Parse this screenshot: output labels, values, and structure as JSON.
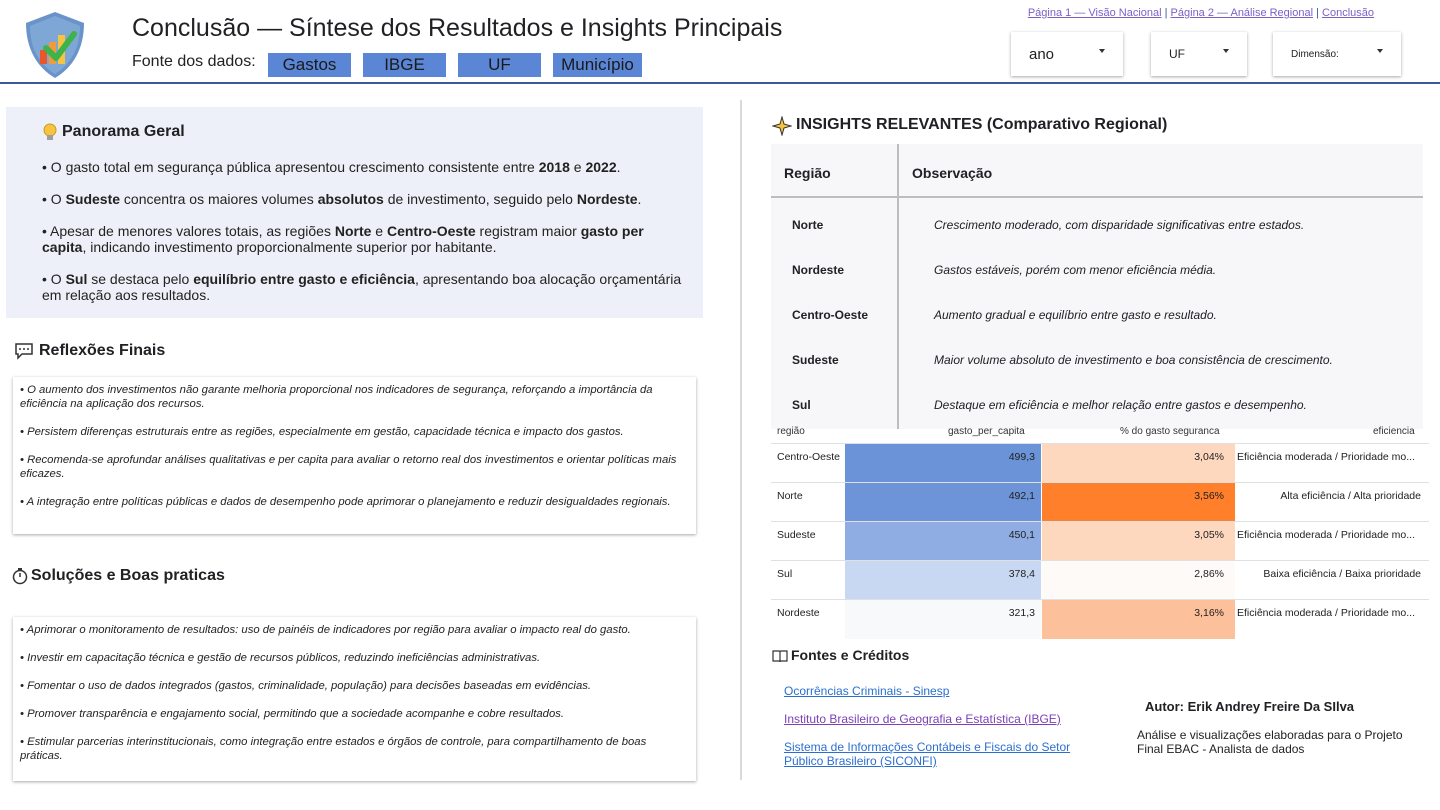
{
  "header": {
    "title": "Conclusão — Síntese dos Resultados e Insights Principais",
    "source_label": "Fonte dos dados:",
    "sources": [
      "Gastos",
      "IBGE",
      "UF",
      "Município"
    ],
    "nav": {
      "page1": "Página 1 — Visão Nacional",
      "sep1": " | ",
      "page2": "Página 2 — Análise Regional",
      "sep2": " | ",
      "page3": "Conclusão"
    },
    "filters": {
      "ano": "ano",
      "uf": "UF",
      "dimensao": "Dimensão:"
    }
  },
  "panorama": {
    "title": "Panorama Geral",
    "p1": {
      "a": "• O gasto total em segurança pública apresentou crescimento consistente entre ",
      "b": "2018",
      "c": " e ",
      "d": "2022",
      "e": "."
    },
    "p2": {
      "a": " • O ",
      "b": "Sudeste",
      "c": " concentra os maiores volumes ",
      "d": "absolutos",
      "e": " de investimento, seguido pelo ",
      "f": "Nordeste",
      "g": "."
    },
    "p3": {
      "a": " • Apesar de menores valores totais, as regiões ",
      "b": "Norte",
      "c": " e ",
      "d": "Centro-Oeste",
      "e": " registram maior ",
      "f": "gasto per capita",
      "g": ", indicando investimento proporcionalmente superior por habitante."
    },
    "p4": {
      "a": " • O ",
      "b": "Sul",
      "c": " se destaca pelo ",
      "d": "equilíbrio entre gasto e eficiência",
      "e": ", apresentando boa alocação orçamentária em relação aos resultados."
    }
  },
  "reflexoes": {
    "title": "Reflexões Finais",
    "items": [
      "• O aumento dos investimentos não garante melhoria proporcional nos indicadores de segurança, reforçando a importância da eficiência na aplicação dos recursos.",
      "• Persistem diferenças estruturais entre as regiões, especialmente em gestão, capacidade técnica e impacto dos gastos.",
      "• Recomenda-se aprofundar análises qualitativas e per capita para avaliar o retorno real dos investimentos e orientar políticas mais eficazes.",
      "• A integração entre políticas públicas e dados de desempenho pode aprimorar o planejamento e reduzir desigualdades regionais."
    ]
  },
  "solucoes": {
    "title": "Soluções e Boas praticas",
    "items": [
      "• Aprimorar o monitoramento de resultados: uso de painéis de indicadores por região para avaliar o impacto real do gasto.",
      "• Investir em capacitação técnica e gestão de recursos públicos, reduzindo ineficiências administrativas.",
      "• Fomentar o uso de dados integrados (gastos, criminalidade, população) para decisões baseadas em evidências.",
      "• Promover transparência e engajamento social, permitindo que a sociedade acompanhe e cobre resultados.",
      "• Estimular parcerias interinstitucionais, como integração entre estados e órgãos de controle, para compartilhamento de boas práticas."
    ]
  },
  "insights": {
    "title": "INSIGHTS RELEVANTES (Comparativo Regional)",
    "col_region": "Região",
    "col_obs": "Observação",
    "rows": [
      {
        "region": "Norte",
        "obs": "Crescimento moderado, com disparidade significativas entre estados."
      },
      {
        "region": "Nordeste",
        "obs": "Gastos estáveis, porém com menor eficiência média."
      },
      {
        "region": "Centro-Oeste",
        "obs": "Aumento gradual e equilíbrio entre gasto e resultado."
      },
      {
        "region": "Sudeste",
        "obs": "Maior volume absoluto de investimento e boa consistência de crescimento."
      },
      {
        "region": "Sul",
        "obs": "Destaque em eficiência e melhor relação entre gastos e desempenho."
      }
    ]
  },
  "table": {
    "headers": [
      "região",
      "gasto_per_capita",
      "% do gasto seguranca",
      "eficiencia"
    ],
    "rows": [
      {
        "regiao": "Centro-Oeste",
        "gasto": "499,3",
        "pct": "3,04%",
        "ef": "Eficiência moderada / Prioridade mo...",
        "gasto_color": "#6b93d8",
        "pct_color": "#fdd8bf"
      },
      {
        "regiao": "Norte",
        "gasto": "492,1",
        "pct": "3,56%",
        "ef": "Alta eficiência / Alta prioridade",
        "gasto_color": "#6d94d8",
        "pct_color": "#ff7f2a"
      },
      {
        "regiao": "Sudeste",
        "gasto": "450,1",
        "pct": "3,05%",
        "ef": "Eficiência moderada / Prioridade mo...",
        "gasto_color": "#8fadE2",
        "pct_color": "#fdd7be"
      },
      {
        "regiao": "Sul",
        "gasto": "378,4",
        "pct": "2,86%",
        "ef": "Baixa eficiência / Baixa prioridade",
        "gasto_color": "#c9d8f2",
        "pct_color": "#fefaf8"
      },
      {
        "regiao": "Nordeste",
        "gasto": "321,3",
        "pct": "3,16%",
        "ef": "Eficiência moderada / Prioridade mo...",
        "gasto_color": "#f8f9fb",
        "pct_color": "#fcc09a"
      }
    ]
  },
  "fontes": {
    "title": "Fontes e Créditos",
    "links": [
      "Ocorrências Criminais - Sinesp",
      "Instituto Brasileiro de Geografia e Estatística (IBGE)",
      "Sistema de Informações Contábeis e Fiscais do Setor Público Brasileiro (SICONFI)"
    ],
    "link_colors": [
      "#2a6fd0",
      "#7b3fb8",
      "#2a6fd0"
    ],
    "autor": "Autor: Erik Andrey Freire Da SIlva",
    "autor_desc": "Análise e visualizações elaboradas para o Projeto Final EBAC - Analista de dados"
  }
}
